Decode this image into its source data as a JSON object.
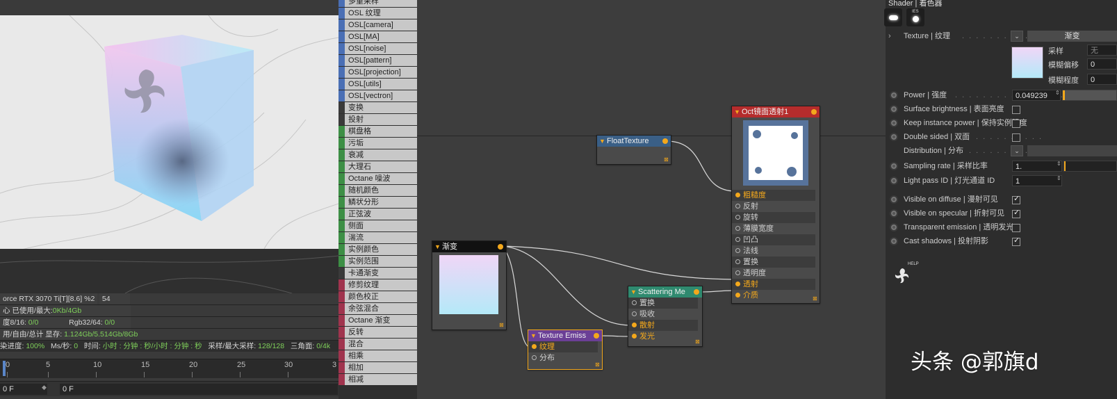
{
  "viewport": {
    "stats": {
      "gpu": "orce RTX 3070 Ti[T][8.6] %2",
      "gpu_val": "54",
      "mem1_a": "心 已使用/最大:",
      "mem1_b": "0Kb/4Gb",
      "tex_a": "度8/16: ",
      "tex_b": "0/0",
      "rgb_a": "Rgb32/64: ",
      "rgb_b": "0/0",
      "vram_a": "用/自由/总计 显存: ",
      "vram_b": "1.124Gb/5.514Gb/8Gb"
    },
    "progress": {
      "p_label": "染进度: ",
      "p_value": "100%",
      "ms_label": "Ms/秒: ",
      "ms_value": "0",
      "time_label": "时间: ",
      "time_value": "小时 : 分钟 : 秒/小时 : 分钟 : 秒",
      "samples_label": "采样/最大采样: ",
      "samples_value": "128/128",
      "tri_label": "三角面: ",
      "tri_value": "0/4k"
    },
    "ruler": [
      "0",
      "5",
      "10",
      "15",
      "20",
      "25",
      "30",
      "3"
    ],
    "frame_start": "0 F",
    "frame_current": "0 F"
  },
  "shader_list": {
    "items": [
      {
        "label": "多重采样",
        "color": "#4a6fb5"
      },
      {
        "label": "OSL 纹理",
        "color": "#4a6fb5"
      },
      {
        "label": "OSL[camera]",
        "color": "#4a6fb5"
      },
      {
        "label": "OSL[MA]",
        "color": "#4a6fb5"
      },
      {
        "label": "OSL[noise]",
        "color": "#4a6fb5"
      },
      {
        "label": "OSL[pattern]",
        "color": "#4a6fb5"
      },
      {
        "label": "OSL[projection]",
        "color": "#4a6fb5"
      },
      {
        "label": "OSL[utils]",
        "color": "#4a6fb5"
      },
      {
        "label": "OSL[vectron]",
        "color": "#4a6fb5"
      },
      {
        "label": "变换",
        "color": "#3a3a3a"
      },
      {
        "label": "投射",
        "color": "#3a3a3a"
      },
      {
        "label": "棋盘格",
        "color": "#3d8f45"
      },
      {
        "label": "污垢",
        "color": "#3d8f45"
      },
      {
        "label": "衰减",
        "color": "#3d8f45"
      },
      {
        "label": "大理石",
        "color": "#3d8f45"
      },
      {
        "label": "Octane 噪波",
        "color": "#3d8f45"
      },
      {
        "label": "随机颜色",
        "color": "#3d8f45"
      },
      {
        "label": "鳞状分形",
        "color": "#3d8f45"
      },
      {
        "label": "正弦波",
        "color": "#3d8f45"
      },
      {
        "label": "侧面",
        "color": "#3d8f45"
      },
      {
        "label": "湍流",
        "color": "#3d8f45"
      },
      {
        "label": "实例颜色",
        "color": "#3d8f45"
      },
      {
        "label": "实例范围",
        "color": "#3d8f45"
      },
      {
        "label": "卡通渐变",
        "color": "#3a3a3a"
      },
      {
        "label": "修剪纹理",
        "color": "#a0344e"
      },
      {
        "label": "颜色校正",
        "color": "#a0344e"
      },
      {
        "label": "余弦混合",
        "color": "#a0344e"
      },
      {
        "label": "Octane 渐变",
        "color": "#a0344e"
      },
      {
        "label": "反转",
        "color": "#a0344e"
      },
      {
        "label": "混合",
        "color": "#a0344e"
      },
      {
        "label": "相乘",
        "color": "#a0344e"
      },
      {
        "label": "相加",
        "color": "#a0344e"
      },
      {
        "label": "相减",
        "color": "#a0344e"
      }
    ]
  },
  "nodes": {
    "float_texture": {
      "title": "FloatTexture"
    },
    "gradient": {
      "title": "渐变"
    },
    "texture_emission": {
      "title": "Texture Emiss",
      "rows": [
        "纹理",
        "分布"
      ]
    },
    "scattering": {
      "title": "Scattering Me",
      "rows": [
        "置换",
        "吸收",
        "散射",
        "发光"
      ]
    },
    "specular": {
      "title": "Oct镜面透射1",
      "rows": [
        "粗糙度",
        "反射",
        "旋转",
        "薄膜宽度",
        "凹凸",
        "法线",
        "置换",
        "透明度",
        "透射",
        "介质"
      ]
    }
  },
  "attributes": {
    "title": "Shader | 着色器",
    "texture_label": "Texture | 纹理",
    "texture_button": "渐变",
    "sampling_label": "采样",
    "blur_offset_label": "模糊偏移",
    "blur_amount_label": "模糊程度",
    "blur_offset_value": "0",
    "blur_amount_value": "0",
    "sampling_value": "无",
    "power_label": "Power | 强度",
    "power_value": "0.049239",
    "surface_brightness_label": "Surface brightness | 表面亮度",
    "keep_instance_label": "Keep instance power | 保持实例强度",
    "double_sided_label": "Double sided | 双面",
    "distribution_label": "Distribution | 分布",
    "sampling_rate_label": "Sampling rate | 采样比率",
    "sampling_rate_value": "1.",
    "light_pass_label": "Light pass ID | 灯光通道 ID",
    "light_pass_value": "1",
    "visible_diffuse_label": "Visible on diffuse | 漫射可见",
    "visible_specular_label": "Visible on specular | 折射可见",
    "transparent_emission_label": "Transparent emission | 透明发光",
    "cast_shadows_label": "Cast shadows | 投射阴影",
    "help_label": "HELP",
    "ies_label": "IES"
  },
  "watermark": "头条 @郭旗d"
}
